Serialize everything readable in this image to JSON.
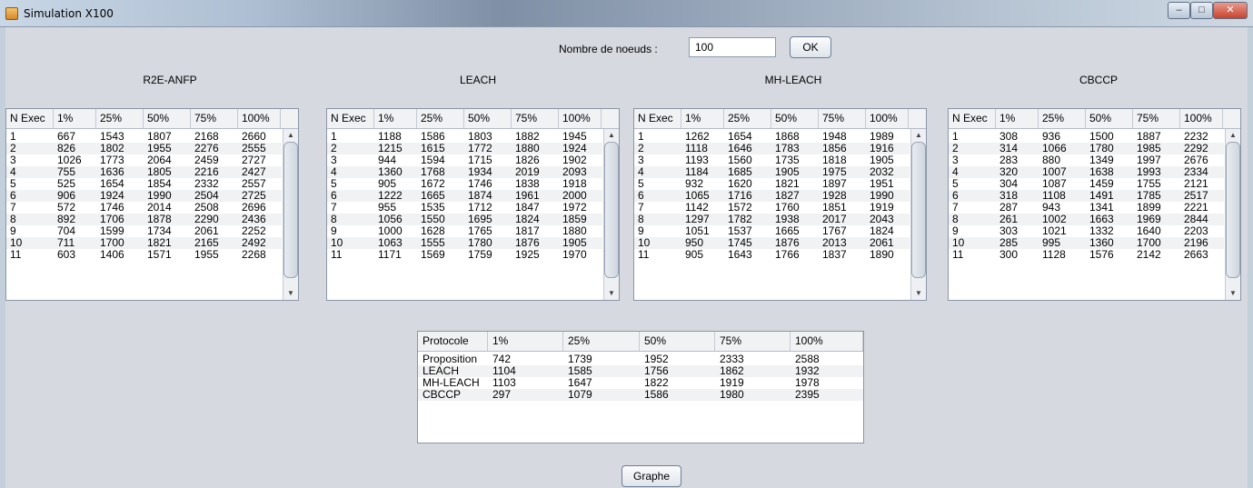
{
  "window": {
    "title": "Simulation X100"
  },
  "controls": {
    "node_label": "Nombre de noeuds :",
    "node_value": "100",
    "ok_label": "OK",
    "graph_label": "Graphe"
  },
  "columns": [
    "N Exec",
    "1%",
    "25%",
    "50%",
    "75%",
    "100%"
  ],
  "tables": [
    {
      "title": "R2E-ANFP",
      "rows": [
        [
          "1",
          "667",
          "1543",
          "1807",
          "2168",
          "2660"
        ],
        [
          "2",
          "826",
          "1802",
          "1955",
          "2276",
          "2555"
        ],
        [
          "3",
          "1026",
          "1773",
          "2064",
          "2459",
          "2727"
        ],
        [
          "4",
          "755",
          "1636",
          "1805",
          "2216",
          "2427"
        ],
        [
          "5",
          "525",
          "1654",
          "1854",
          "2332",
          "2557"
        ],
        [
          "6",
          "906",
          "1924",
          "1990",
          "2504",
          "2725"
        ],
        [
          "7",
          "572",
          "1746",
          "2014",
          "2508",
          "2696"
        ],
        [
          "8",
          "892",
          "1706",
          "1878",
          "2290",
          "2436"
        ],
        [
          "9",
          "704",
          "1599",
          "1734",
          "2061",
          "2252"
        ],
        [
          "10",
          "711",
          "1700",
          "1821",
          "2165",
          "2492"
        ],
        [
          "11",
          "603",
          "1406",
          "1571",
          "1955",
          "2268"
        ]
      ]
    },
    {
      "title": "LEACH",
      "rows": [
        [
          "1",
          "1188",
          "1586",
          "1803",
          "1882",
          "1945"
        ],
        [
          "2",
          "1215",
          "1615",
          "1772",
          "1880",
          "1924"
        ],
        [
          "3",
          "944",
          "1594",
          "1715",
          "1826",
          "1902"
        ],
        [
          "4",
          "1360",
          "1768",
          "1934",
          "2019",
          "2093"
        ],
        [
          "5",
          "905",
          "1672",
          "1746",
          "1838",
          "1918"
        ],
        [
          "6",
          "1222",
          "1665",
          "1874",
          "1961",
          "2000"
        ],
        [
          "7",
          "955",
          "1535",
          "1712",
          "1847",
          "1972"
        ],
        [
          "8",
          "1056",
          "1550",
          "1695",
          "1824",
          "1859"
        ],
        [
          "9",
          "1000",
          "1628",
          "1765",
          "1817",
          "1880"
        ],
        [
          "10",
          "1063",
          "1555",
          "1780",
          "1876",
          "1905"
        ],
        [
          "11",
          "1171",
          "1569",
          "1759",
          "1925",
          "1970"
        ]
      ]
    },
    {
      "title": "MH-LEACH",
      "rows": [
        [
          "1",
          "1262",
          "1654",
          "1868",
          "1948",
          "1989"
        ],
        [
          "2",
          "1118",
          "1646",
          "1783",
          "1856",
          "1916"
        ],
        [
          "3",
          "1193",
          "1560",
          "1735",
          "1818",
          "1905"
        ],
        [
          "4",
          "1184",
          "1685",
          "1905",
          "1975",
          "2032"
        ],
        [
          "5",
          "932",
          "1620",
          "1821",
          "1897",
          "1951"
        ],
        [
          "6",
          "1065",
          "1716",
          "1827",
          "1928",
          "1990"
        ],
        [
          "7",
          "1142",
          "1572",
          "1760",
          "1851",
          "1919"
        ],
        [
          "8",
          "1297",
          "1782",
          "1938",
          "2017",
          "2043"
        ],
        [
          "9",
          "1051",
          "1537",
          "1665",
          "1767",
          "1824"
        ],
        [
          "10",
          "950",
          "1745",
          "1876",
          "2013",
          "2061"
        ],
        [
          "11",
          "905",
          "1643",
          "1766",
          "1837",
          "1890"
        ]
      ]
    },
    {
      "title": "CBCCP",
      "rows": [
        [
          "1",
          "308",
          "936",
          "1500",
          "1887",
          "2232"
        ],
        [
          "2",
          "314",
          "1066",
          "1780",
          "1985",
          "2292"
        ],
        [
          "3",
          "283",
          "880",
          "1349",
          "1997",
          "2676"
        ],
        [
          "4",
          "320",
          "1007",
          "1638",
          "1993",
          "2334"
        ],
        [
          "5",
          "304",
          "1087",
          "1459",
          "1755",
          "2121"
        ],
        [
          "6",
          "318",
          "1108",
          "1491",
          "1785",
          "2517"
        ],
        [
          "7",
          "287",
          "943",
          "1341",
          "1899",
          "2221"
        ],
        [
          "8",
          "261",
          "1002",
          "1663",
          "1969",
          "2844"
        ],
        [
          "9",
          "303",
          "1021",
          "1332",
          "1640",
          "2203"
        ],
        [
          "10",
          "285",
          "995",
          "1360",
          "1700",
          "2196"
        ],
        [
          "11",
          "300",
          "1128",
          "1576",
          "2142",
          "2663"
        ]
      ]
    }
  ],
  "summary": {
    "columns": [
      "Protocole",
      "1%",
      "25%",
      "50%",
      "75%",
      "100%"
    ],
    "rows": [
      [
        "Proposition",
        "742",
        "1739",
        "1952",
        "2333",
        "2588"
      ],
      [
        "LEACH",
        "1104",
        "1585",
        "1756",
        "1862",
        "1932"
      ],
      [
        "MH-LEACH",
        "1103",
        "1647",
        "1822",
        "1919",
        "1978"
      ],
      [
        "CBCCP",
        "297",
        "1079",
        "1586",
        "1980",
        "2395"
      ]
    ]
  }
}
